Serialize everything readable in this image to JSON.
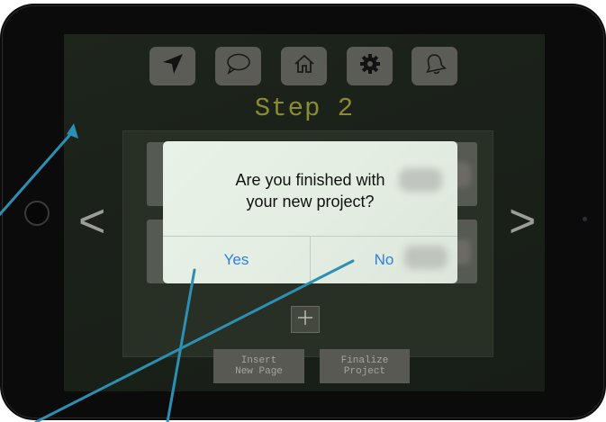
{
  "toolbar": {
    "items": [
      {
        "icon": "location-arrow-icon"
      },
      {
        "icon": "chat-bubble-icon"
      },
      {
        "icon": "home-icon"
      },
      {
        "icon": "gear-icon"
      },
      {
        "icon": "bell-icon"
      }
    ]
  },
  "page": {
    "title": "Step 2"
  },
  "navigation": {
    "prev": "<",
    "next": ">"
  },
  "add_button": {
    "label": "+"
  },
  "actions": {
    "insert_page": "Insert\nNew Page",
    "finalize": "Finalize\nProject"
  },
  "dialog": {
    "message_line1": "Are you finished with",
    "message_line2": "your new project?",
    "yes_label": "Yes",
    "no_label": "No"
  },
  "colors": {
    "accent": "#2e7fe6",
    "title": "#8c8a2e",
    "annotation": "#2c8fb3"
  }
}
